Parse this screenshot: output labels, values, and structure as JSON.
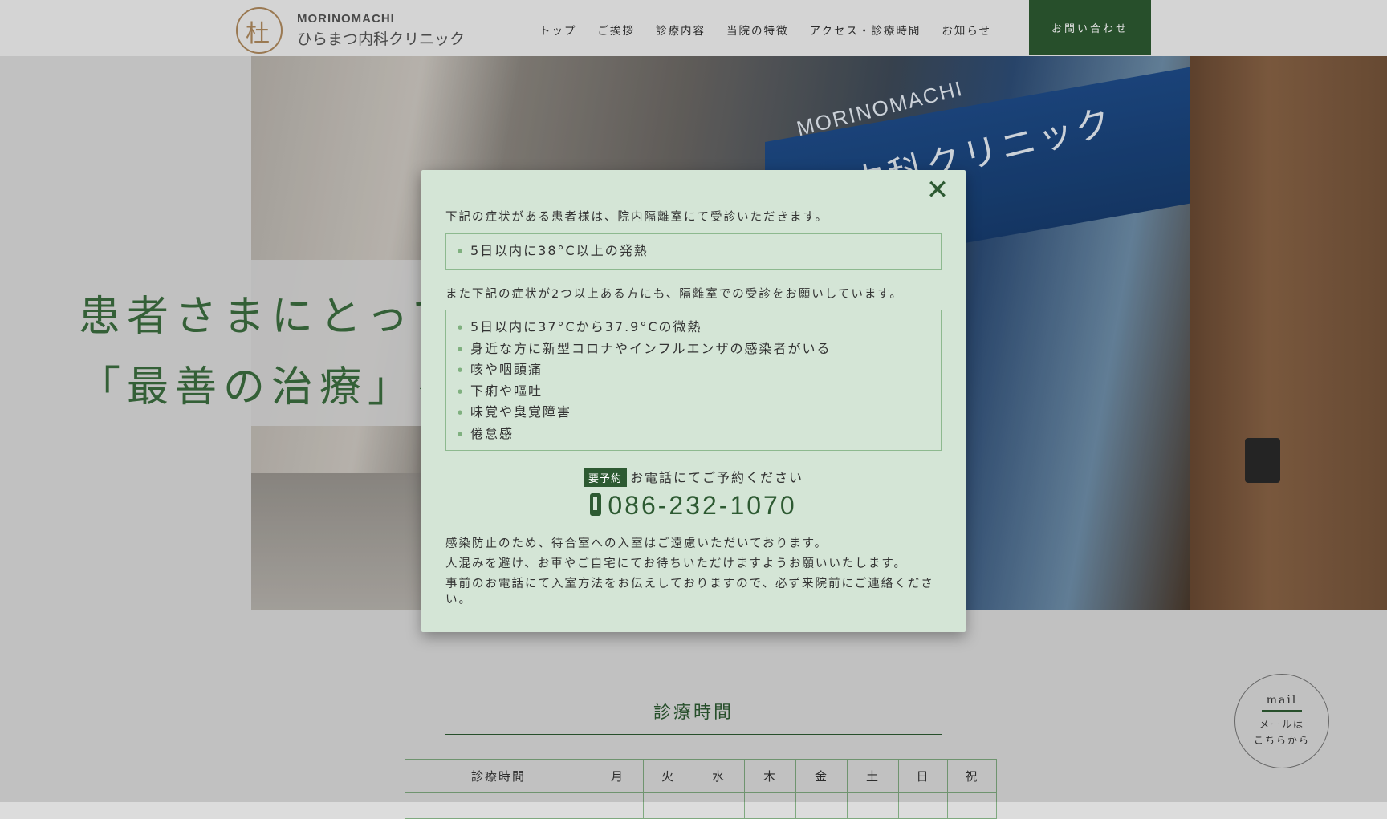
{
  "header": {
    "logo_mark": "杜",
    "logo_en": "MORINOMACHI",
    "logo_ja": "ひらまつ内科クリニック",
    "nav": [
      "トップ",
      "ご挨拶",
      "診療内容",
      "当院の特徴",
      "アクセス・診療時間",
      "お知らせ"
    ],
    "contact_label": "お問い合わせ"
  },
  "hero": {
    "sign_en": "MORINOMACHI",
    "sign_ja": "内科クリニック",
    "catch_line1": "患者さまにとって",
    "catch_line2": "「最善の治療」を"
  },
  "modal": {
    "close_icon": "close-icon",
    "intro": "下記の症状がある患者様は、院内隔離室にて受診いただきます。",
    "list1": [
      "5日以内に38°C以上の発熱"
    ],
    "intro2": "また下記の症状が2つ以上ある方にも、隔離室での受診をお願いしています。",
    "list2": [
      "5日以内に37°Cから37.9°Cの微熱",
      "身近な方に新型コロナやインフルエンザの感染者がいる",
      "咳や咽頭痛",
      "下痢や嘔吐",
      "味覚や臭覚障害",
      "倦怠感"
    ],
    "reserve_badge": "要予約",
    "reserve_text": "お電話にてご予約ください",
    "phone": "086-232-1070",
    "note1": "感染防止のため、待合室への入室はご遠慮いただいております。",
    "note2": "人混みを避け、お車やご自宅にてお待ちいただけますようお願いいたします。",
    "note3": "事前のお電話にて入室方法をお伝えしておりますので、必ず来院前にご連絡ください。"
  },
  "hours": {
    "title": "診療時間",
    "columns": [
      "診療時間",
      "月",
      "火",
      "水",
      "木",
      "金",
      "土",
      "日",
      "祝"
    ]
  },
  "mail": {
    "en": "mail",
    "ja_line1": "メールは",
    "ja_line2": "こちらから"
  },
  "colors": {
    "accent": "#2d5a32",
    "modal_bg": "#d4e5d6",
    "logo": "#b08a5e"
  }
}
